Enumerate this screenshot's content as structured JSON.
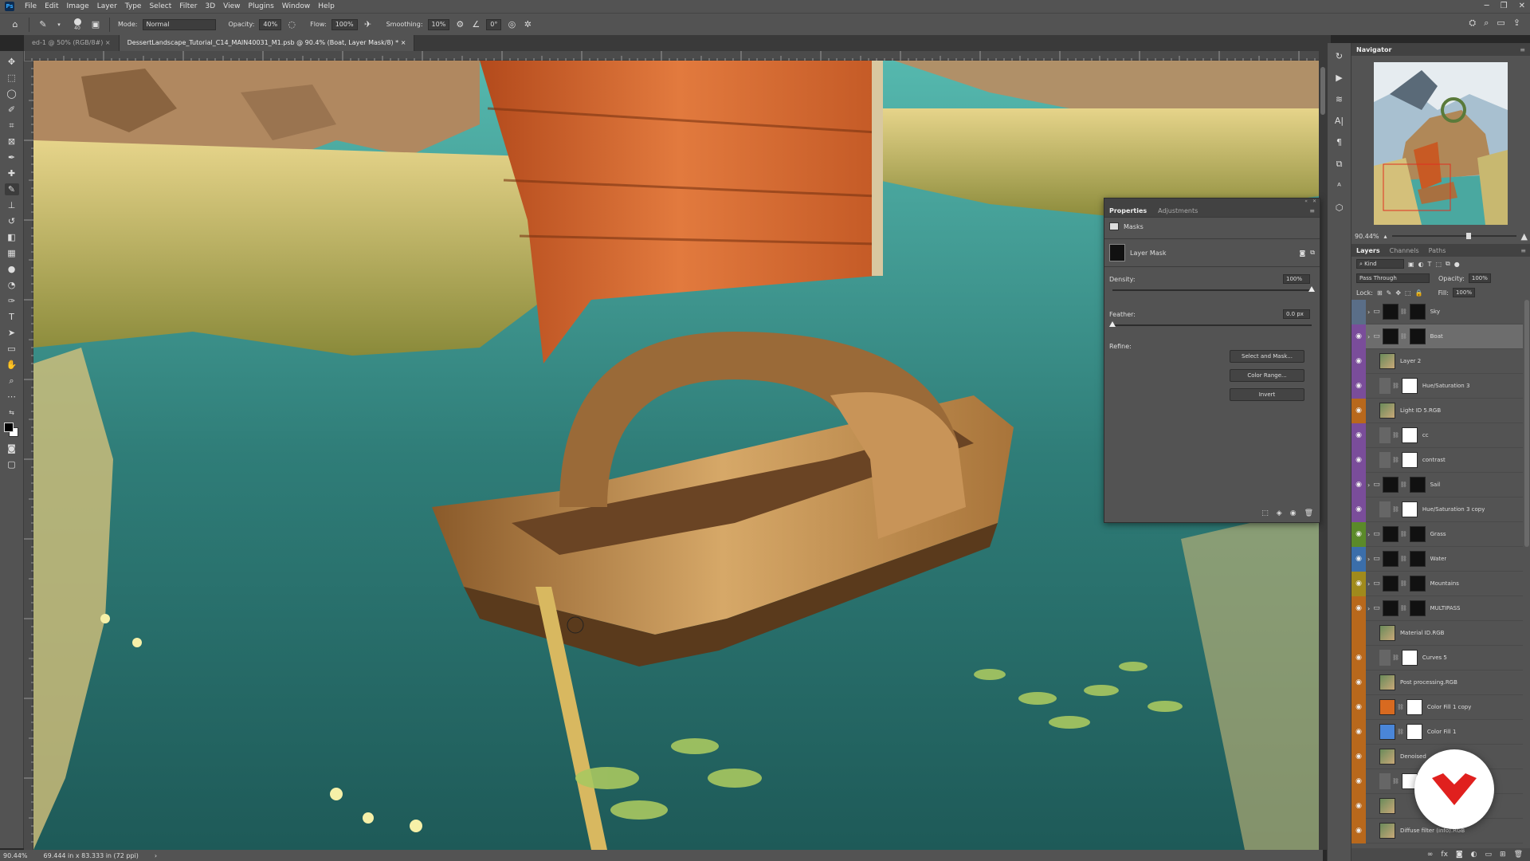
{
  "menubar": {
    "items": [
      "File",
      "Edit",
      "Image",
      "Layer",
      "Type",
      "Select",
      "Filter",
      "3D",
      "View",
      "Plugins",
      "Window",
      "Help"
    ],
    "logo": "Ps"
  },
  "options": {
    "brush_size": "40",
    "mode_label": "Mode:",
    "mode_value": "Normal",
    "opacity_label": "Opacity:",
    "opacity_value": "40%",
    "flow_label": "Flow:",
    "flow_value": "100%",
    "smoothing_label": "Smoothing:",
    "smoothing_value": "10%",
    "angle_value": "0°"
  },
  "tabs": [
    {
      "label": "ed-1 @ 50% (RGB/8#)",
      "active": false
    },
    {
      "label": "DessertLandscape_Tutorial_C14_MAIN40031_M1.psb @ 90.4% (Boat, Layer Mask/8) *",
      "active": true
    }
  ],
  "status": {
    "zoom": "90.44%",
    "doc_size": "69.444 in x 83.333 in (72 ppi)"
  },
  "navigator": {
    "title": "Navigator",
    "zoom": "90.44%"
  },
  "properties": {
    "tabs": [
      "Properties",
      "Adjustments"
    ],
    "section": "Masks",
    "mask_label": "Layer Mask",
    "density_label": "Density:",
    "density_value": "100%",
    "density_level": 1.0,
    "feather_label": "Feather:",
    "feather_value": "0.0 px",
    "feather_level": 0.0,
    "refine_label": "Refine:",
    "btn_select_mask": "Select and Mask...",
    "btn_color_range": "Color Range...",
    "btn_invert": "Invert"
  },
  "layers_panel": {
    "tabs": [
      "Layers",
      "Channels",
      "Paths"
    ],
    "kind_label": "Kind",
    "blend_mode": "Pass Through",
    "opacity_label": "Opacity:",
    "opacity_value": "100%",
    "lock_label": "Lock:",
    "fill_label": "Fill:",
    "fill_value": "100%",
    "layers": [
      {
        "name": "Sky",
        "type": "group",
        "color": "#5a6e88",
        "eye": false
      },
      {
        "name": "Boat",
        "type": "group",
        "color": "#7a4d9a",
        "eye": true,
        "selected": true
      },
      {
        "name": "Layer 2",
        "type": "pixel",
        "color": "#7a4d9a",
        "eye": true
      },
      {
        "name": "Hue/Saturation 3",
        "type": "adjust",
        "color": "#7a4d9a",
        "eye": true
      },
      {
        "name": "Light ID 5.RGB",
        "type": "pixel",
        "color": "#b8681c",
        "eye": true
      },
      {
        "name": "cc",
        "type": "adjust",
        "color": "#7a4d9a",
        "eye": true
      },
      {
        "name": "contrast",
        "type": "adjust",
        "color": "#7a4d9a",
        "eye": true
      },
      {
        "name": "Sail",
        "type": "group",
        "color": "#7a4d9a",
        "eye": true
      },
      {
        "name": "Hue/Saturation 3 copy",
        "type": "adjust",
        "color": "#7a4d9a",
        "eye": true
      },
      {
        "name": "Grass",
        "type": "group",
        "color": "#5b8a2a",
        "eye": true
      },
      {
        "name": "Water",
        "type": "group",
        "color": "#3b6eaa",
        "eye": true
      },
      {
        "name": "Mountains",
        "type": "group",
        "color": "#a08a1c",
        "eye": true
      },
      {
        "name": "MULTIPASS",
        "type": "group",
        "color": "#b8681c",
        "eye": true
      },
      {
        "name": "Material ID.RGB",
        "type": "pixel",
        "color": "#b8681c",
        "eye": false
      },
      {
        "name": "Curves 5",
        "type": "adjust",
        "color": "#b8681c",
        "eye": true
      },
      {
        "name": "Post processing.RGB",
        "type": "pixel",
        "color": "#b8681c",
        "eye": true
      },
      {
        "name": "Color Fill 1 copy",
        "type": "fill",
        "color": "#b8681c",
        "eye": true
      },
      {
        "name": "Color Fill 1",
        "type": "fill",
        "color": "#b8681c",
        "eye": true
      },
      {
        "name": "Denoised",
        "type": "pixel",
        "color": "#b8681c",
        "eye": true
      },
      {
        "name": "",
        "type": "adjust",
        "color": "#b8681c",
        "eye": true
      },
      {
        "name": "",
        "type": "pixel",
        "color": "#b8681c",
        "eye": true
      },
      {
        "name": "Diffuse filter (info).RGB",
        "type": "pixel",
        "color": "#b8681c",
        "eye": true
      }
    ]
  },
  "colors": {
    "ui_bg": "#535353",
    "water": "#2a6d6a",
    "sail": "#c85a24",
    "brand": "#e0201e"
  }
}
